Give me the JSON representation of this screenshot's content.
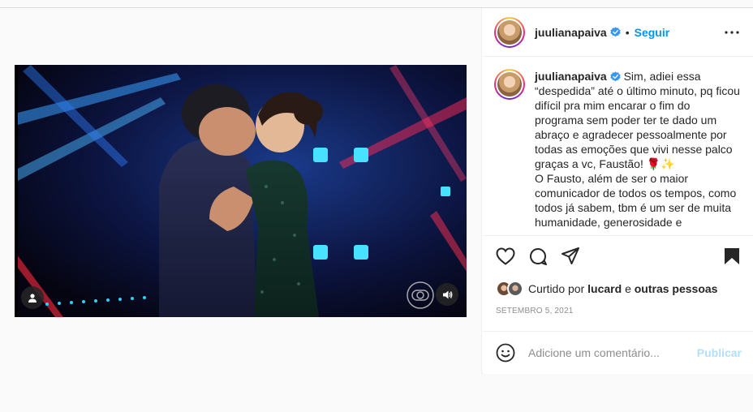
{
  "post": {
    "username": "juulianapaiva",
    "dot": "•",
    "follow_label": "Seguir",
    "caption": {
      "username": "juulianapaiva",
      "text": "Sim, adiei essa “despedida” até o último minuto, pq ficou difícil pra mim encarar o fim do programa sem poder ter te dado um abraço e agradecer pessoalmente por todas as emoções que vivi nesse palco graças a vc, Faustão! 🌹✨",
      "text2": "O Fausto, além de ser o maior comunicador de todos os tempos, como todos já sabem, tbm é um ser de muita humanidade, generosidade e"
    },
    "likes": {
      "prefix": "Curtido por",
      "user": "lucard",
      "joiner": "e",
      "others": "outras pessoas"
    },
    "date": "SETEMBRO 5, 2021",
    "comment": {
      "placeholder": "Adicione um comentário...",
      "publish_label": "Publicar"
    }
  },
  "icons": {
    "more": "more-horizontal-icon",
    "like": "heart-icon",
    "comment": "comment-icon",
    "share": "share-icon",
    "save": "bookmark-icon",
    "emoji": "emoji-icon",
    "verified": "verified-badge-icon",
    "sound": "sound-icon",
    "user_tag": "user-tag-icon"
  },
  "colors": {
    "accent": "#0095f6",
    "publish_disabled": "#b2dffc",
    "muted": "#8e8e8e",
    "text": "#262626"
  }
}
